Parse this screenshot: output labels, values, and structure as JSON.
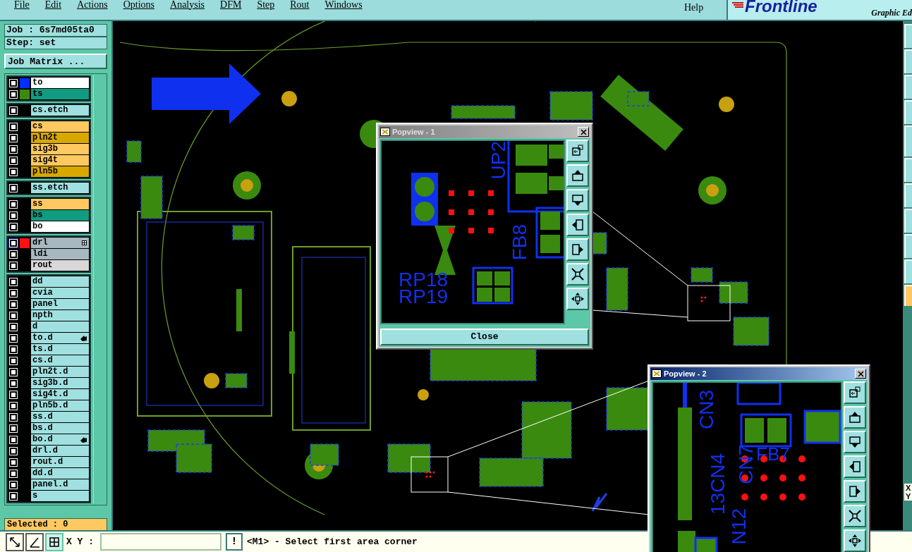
{
  "menu": [
    {
      "label": "File"
    },
    {
      "label": "Edit"
    },
    {
      "label": "Actions"
    },
    {
      "label": "Options"
    },
    {
      "label": "Analysis"
    },
    {
      "label": "DFM"
    },
    {
      "label": "Step"
    },
    {
      "label": "Rout"
    },
    {
      "label": "Windows"
    }
  ],
  "help": "Help",
  "logo": {
    "brand": "Frontline",
    "subtitle": "Graphic Ed"
  },
  "job": {
    "job": "Job : 6s7md05ta0",
    "step": "Step: set",
    "matrix_button": "Job Matrix ..."
  },
  "layer_groups": [
    [
      {
        "name": "to",
        "color": "#ffffff",
        "swatch": {
          "color": "#0030ff"
        },
        "checked": false,
        "selected": false
      },
      {
        "name": "ts",
        "color": "#119b80",
        "swatch": {
          "color": "#3a8a10"
        },
        "checked": false,
        "selected": false
      }
    ],
    [
      {
        "name": "cs.etch",
        "color": "#a0e0e0",
        "checked": false,
        "selected": false
      }
    ],
    [
      {
        "name": "cs",
        "color": "#ffc860",
        "checked": false,
        "selected": false
      },
      {
        "name": "pln2t",
        "color": "#d8a800",
        "checked": false,
        "selected": false
      },
      {
        "name": "sig3b",
        "color": "#ffc860",
        "checked": false,
        "selected": false
      },
      {
        "name": "sig4t",
        "color": "#ffc860",
        "checked": false,
        "selected": false
      },
      {
        "name": "pln5b",
        "color": "#d8a800",
        "checked": false,
        "selected": false
      }
    ],
    [
      {
        "name": "ss.etch",
        "color": "#a0e0e0",
        "checked": false,
        "selected": false
      }
    ],
    [
      {
        "name": "ss",
        "color": "#ffc860",
        "checked": false,
        "selected": false
      },
      {
        "name": "bs",
        "color": "#119b80",
        "checked": false,
        "selected": false
      },
      {
        "name": "bo",
        "color": "#ffffff",
        "checked": false,
        "selected": false
      }
    ],
    [
      {
        "name": "drl",
        "color": "#a8b8c0",
        "swatch": {
          "color": "#ff1010"
        },
        "checked": false,
        "selected": true,
        "expandable": true
      },
      {
        "name": "ldi",
        "color": "#a8b8c0",
        "checked": false,
        "selected": false
      },
      {
        "name": "rout",
        "color": "#d8d8d8",
        "checked": false,
        "selected": false
      }
    ],
    [
      {
        "name": "dd",
        "color": "#a0e0e0",
        "checked": false,
        "selected": false
      },
      {
        "name": "cvia",
        "color": "#a0e0e0",
        "checked": false,
        "selected": false
      },
      {
        "name": "panel",
        "color": "#a0e0e0",
        "checked": false,
        "selected": false
      },
      {
        "name": "npth",
        "color": "#a0e0e0",
        "checked": false,
        "selected": false
      },
      {
        "name": "d",
        "color": "#a0e0e0",
        "checked": false,
        "selected": false
      },
      {
        "name": "to.d",
        "color": "#a0e0e0",
        "checked": false,
        "selected": false,
        "pointer": true
      },
      {
        "name": "ts.d",
        "color": "#a0e0e0",
        "checked": false,
        "selected": false
      },
      {
        "name": "cs.d",
        "color": "#a0e0e0",
        "checked": false,
        "selected": false
      },
      {
        "name": "pln2t.d",
        "color": "#a0e0e0",
        "checked": false,
        "selected": false
      },
      {
        "name": "sig3b.d",
        "color": "#a0e0e0",
        "checked": false,
        "selected": false
      },
      {
        "name": "sig4t.d",
        "color": "#a0e0e0",
        "checked": false,
        "selected": false
      },
      {
        "name": "pln5b.d",
        "color": "#a0e0e0",
        "checked": false,
        "selected": false
      },
      {
        "name": "ss.d",
        "color": "#a0e0e0",
        "checked": false,
        "selected": false
      },
      {
        "name": "bs.d",
        "color": "#a0e0e0",
        "checked": false,
        "selected": false
      },
      {
        "name": "bo.d",
        "color": "#a0e0e0",
        "checked": false,
        "selected": false,
        "pointer": true
      },
      {
        "name": "drl.d",
        "color": "#a0e0e0",
        "checked": false,
        "selected": false
      },
      {
        "name": "rout.d",
        "color": "#a0e0e0",
        "checked": false,
        "selected": false
      },
      {
        "name": "dd.d",
        "color": "#a0e0e0",
        "checked": false,
        "selected": false
      },
      {
        "name": "panel.d",
        "color": "#a0e0e0",
        "checked": false,
        "selected": false
      },
      {
        "name": "s",
        "color": "#a0e0e0",
        "checked": false,
        "selected": false
      }
    ]
  ],
  "selected_count": "Selected : 0",
  "bottom": {
    "xy_label": "X Y :",
    "confirm": "!",
    "status": "<M1> - Select first area corner"
  },
  "coord_labels": [
    "X",
    "Y"
  ],
  "popviews": [
    {
      "title": "Popview - 1",
      "active": false,
      "labels": [
        {
          "text": "UP2",
          "kind": "vertical"
        },
        {
          "text": "FB8",
          "kind": "vertical"
        },
        {
          "text": "RP18",
          "kind": "horizontal"
        },
        {
          "text": "RP19",
          "kind": "horizontal"
        }
      ],
      "close_button": "Close"
    },
    {
      "title": "Popview - 2",
      "active": true,
      "labels": [
        {
          "text": "CN3",
          "kind": "vertical"
        },
        {
          "text": "FB7",
          "kind": "horizontal"
        },
        {
          "text": "CN7",
          "kind": "vertical"
        },
        {
          "text": "13CN4",
          "kind": "vertical"
        },
        {
          "text": "N12",
          "kind": "vertical"
        }
      ]
    }
  ]
}
